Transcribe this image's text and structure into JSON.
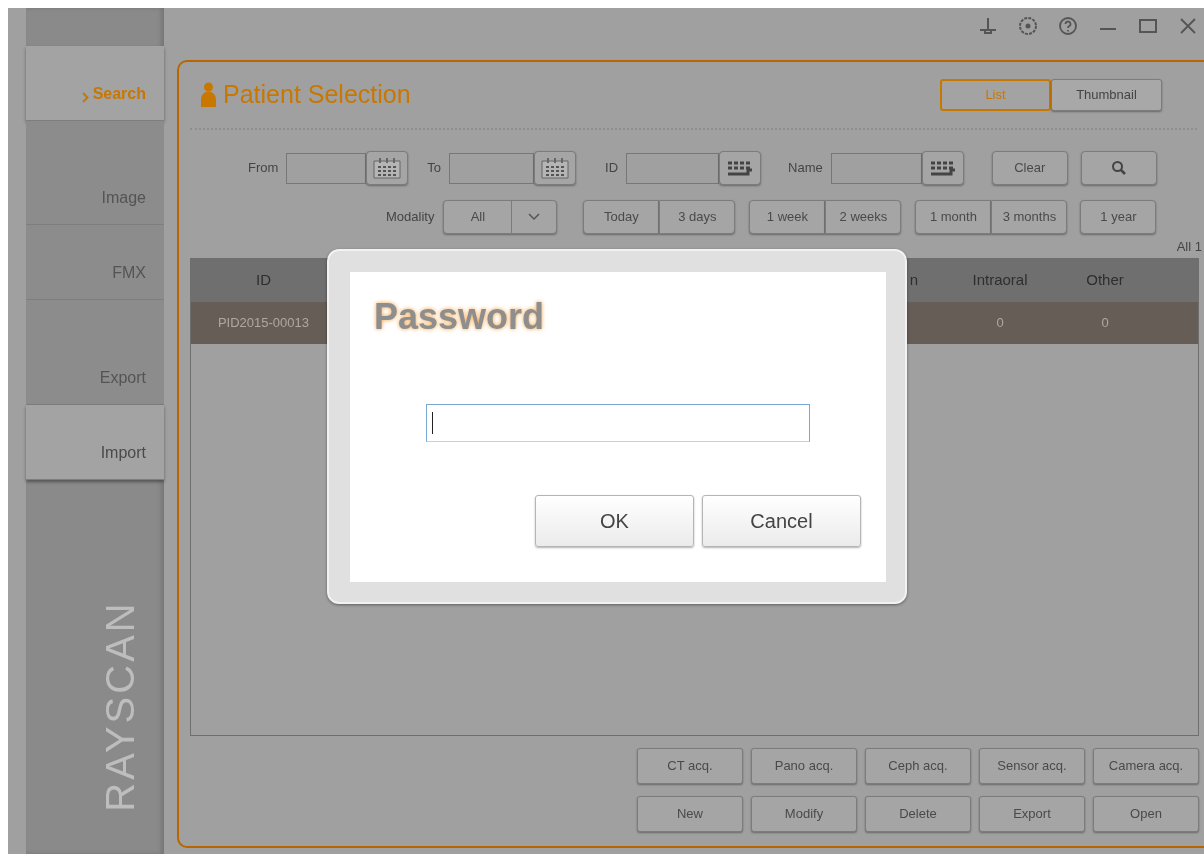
{
  "sidebar": {
    "items": [
      {
        "label": "Search",
        "selected": true,
        "disabled": false
      },
      {
        "label": "Image",
        "selected": false,
        "disabled": true
      },
      {
        "label": "FMX",
        "selected": false,
        "disabled": true
      },
      {
        "label": "Export",
        "selected": false,
        "disabled": true
      },
      {
        "label": "Import",
        "selected": false,
        "disabled": false
      }
    ],
    "brand": "RAYSCAN"
  },
  "panel": {
    "title": "Patient Selection",
    "view_toggle": [
      {
        "label": "List",
        "selected": true
      },
      {
        "label": "Thumbnail",
        "selected": false
      }
    ]
  },
  "filters": {
    "from_label": "From",
    "to_label": "To",
    "id_label": "ID",
    "name_label": "Name",
    "clear": "Clear",
    "modality": {
      "label": "Modality",
      "value": "All"
    },
    "periods": [
      [
        "Today",
        "3 days"
      ],
      [
        "1 week",
        "2 weeks"
      ],
      [
        "1 month",
        "3 months"
      ],
      [
        "1 year"
      ]
    ]
  },
  "count": "All 1",
  "table": {
    "columns": [
      "ID",
      "n",
      "Intraoral",
      "Other"
    ],
    "rows": [
      {
        "selected": true,
        "id": "PID2015-00013",
        "intraoral": "0",
        "other": "0"
      }
    ]
  },
  "actions": [
    [
      "CT acq.",
      "Pano acq.",
      "Ceph acq.",
      "Sensor acq.",
      "Camera acq."
    ],
    [
      "New",
      "Modify",
      "Delete",
      "Export",
      "Open"
    ]
  ],
  "dialog": {
    "title": "Password",
    "buttons": [
      "OK",
      "Cancel"
    ]
  }
}
